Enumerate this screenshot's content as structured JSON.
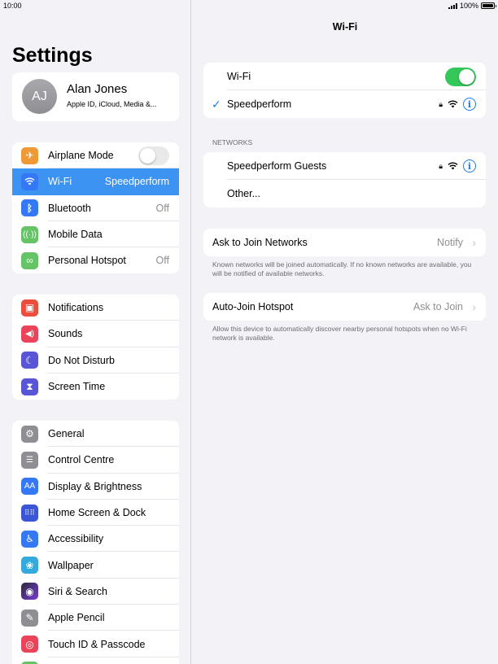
{
  "status_bar": {
    "time": "10:00",
    "battery": "100%"
  },
  "left": {
    "title": "Settings",
    "profile": {
      "initials": "AJ",
      "name": "Alan Jones",
      "subtitle": "Apple ID, iCloud, Media &..."
    },
    "group1": [
      {
        "label": "Airplane Mode",
        "color": "#f09a37",
        "icon": "airplane-icon"
      },
      {
        "label": "Wi-Fi",
        "value": "Speedperform",
        "color": "#3478f6",
        "icon": "wifi-icon"
      },
      {
        "label": "Bluetooth",
        "value": "Off",
        "color": "#3478f6",
        "icon": "bluetooth-icon"
      },
      {
        "label": "Mobile Data",
        "color": "#65c466",
        "icon": "antenna-icon"
      },
      {
        "label": "Personal Hotspot",
        "value": "Off",
        "color": "#65c466",
        "icon": "hotspot-icon"
      }
    ],
    "group2": [
      {
        "label": "Notifications",
        "color": "#eb4e3d",
        "icon": "notifications-icon"
      },
      {
        "label": "Sounds",
        "color": "#eb445a",
        "icon": "speaker-icon"
      },
      {
        "label": "Do Not Disturb",
        "color": "#5856d6",
        "icon": "moon-icon"
      },
      {
        "label": "Screen Time",
        "color": "#5856d6",
        "icon": "hourglass-icon"
      }
    ],
    "group3": [
      {
        "label": "General",
        "color": "#8e8e93",
        "icon": "gear-icon"
      },
      {
        "label": "Control Centre",
        "color": "#8e8e93",
        "icon": "switches-icon"
      },
      {
        "label": "Display & Brightness",
        "color": "#3478f6",
        "icon": "text-size-icon"
      },
      {
        "label": "Home Screen & Dock",
        "color": "#3a55d6",
        "icon": "grid-icon"
      },
      {
        "label": "Accessibility",
        "color": "#3478f6",
        "icon": "accessibility-icon"
      },
      {
        "label": "Wallpaper",
        "color": "#34aadc",
        "icon": "flower-icon"
      },
      {
        "label": "Siri & Search",
        "color": "#2b2b3a",
        "icon": "siri-icon"
      },
      {
        "label": "Apple Pencil",
        "color": "#8e8e93",
        "icon": "pencil-icon"
      },
      {
        "label": "Touch ID & Passcode",
        "color": "#eb445a",
        "icon": "fingerprint-icon"
      }
    ]
  },
  "right": {
    "title": "Wi-Fi",
    "wifi_label": "Wi-Fi",
    "connected": "Speedperform",
    "networks_header": "NETWORKS",
    "networks": [
      "Speedperform Guests",
      "Other..."
    ],
    "ask": {
      "label": "Ask to Join Networks",
      "value": "Notify",
      "footer": "Known networks will be joined automatically. If no known networks are available, you will be notified of available networks."
    },
    "autojoin": {
      "label": "Auto-Join Hotspot",
      "value": "Ask to Join",
      "footer": "Allow this device to automatically discover nearby personal hotspots when no Wi-Fi network is available."
    }
  }
}
